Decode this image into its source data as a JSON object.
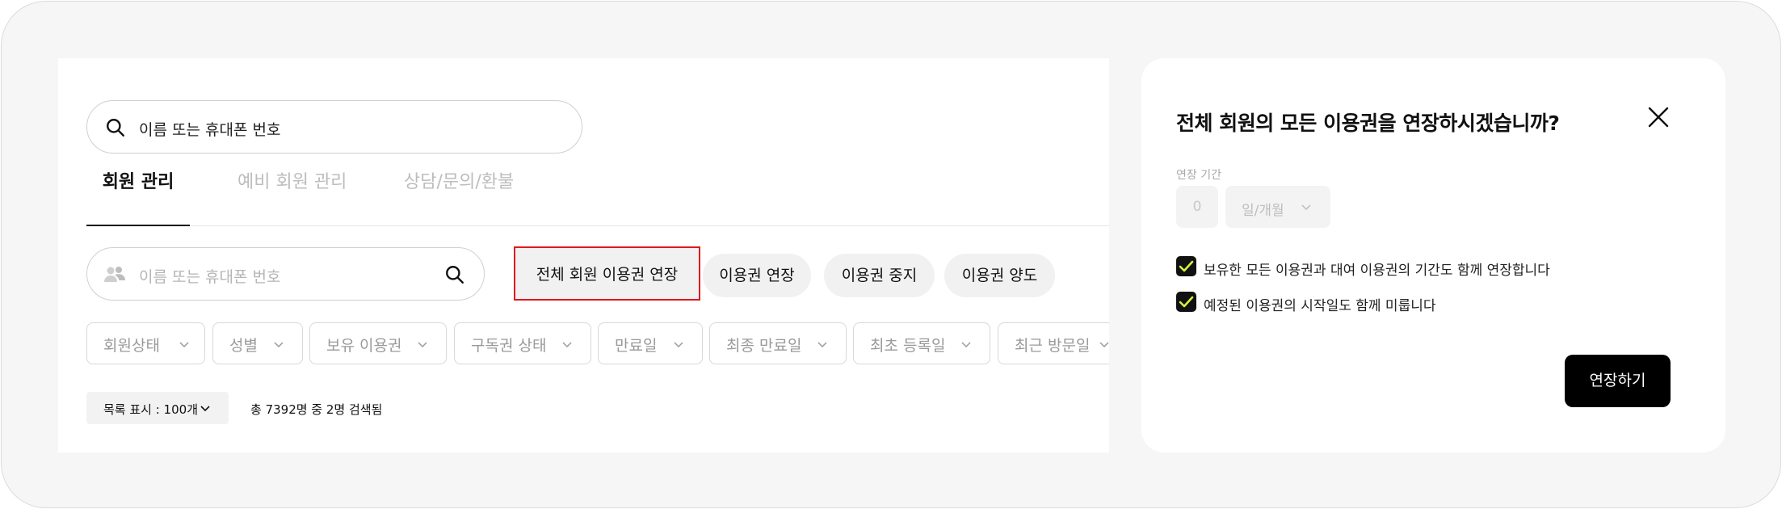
{
  "global_search": {
    "text": "이름 또는 휴대폰 번호"
  },
  "tabs": [
    {
      "label": "회원 관리"
    },
    {
      "label": "예비 회원 관리"
    },
    {
      "label": "상담/문의/환불"
    }
  ],
  "member_search": {
    "placeholder": "이름 또는 휴대폰 번호"
  },
  "actions": {
    "extend_all": "전체 회원 이용권 연장",
    "extend": "이용권 연장",
    "pause": "이용권 중지",
    "transfer": "이용권 양도"
  },
  "filters": [
    {
      "label": "회원상태"
    },
    {
      "label": "성별"
    },
    {
      "label": "보유 이용권"
    },
    {
      "label": "구독권 상태"
    },
    {
      "label": "만료일"
    },
    {
      "label": "최종 만료일"
    },
    {
      "label": "최초 등록일"
    },
    {
      "label": "최근 방문일"
    }
  ],
  "list": {
    "size_label": "목록 표시 : 100개",
    "result_text": "총 7392명 중 2명 검색됨"
  },
  "modal": {
    "title": "전체 회원의 모든 이용권을 연장하시겠습니까?",
    "period_label": "연장 기간",
    "period_value": "0",
    "period_unit": "일/개월",
    "checkbox_1": "보유한 모든 이용권과 대여 이용권의 기간도 함께 연장합니다",
    "checkbox_1_checked": true,
    "checkbox_2": "예정된 이용권의 시작일도 함께 미룹니다",
    "checkbox_2_checked": true,
    "confirm_label": "연장하기"
  },
  "colors": {
    "highlight_border": "#e0181e",
    "checkbox_check": "#d6f23a",
    "primary_button": "#000000"
  }
}
